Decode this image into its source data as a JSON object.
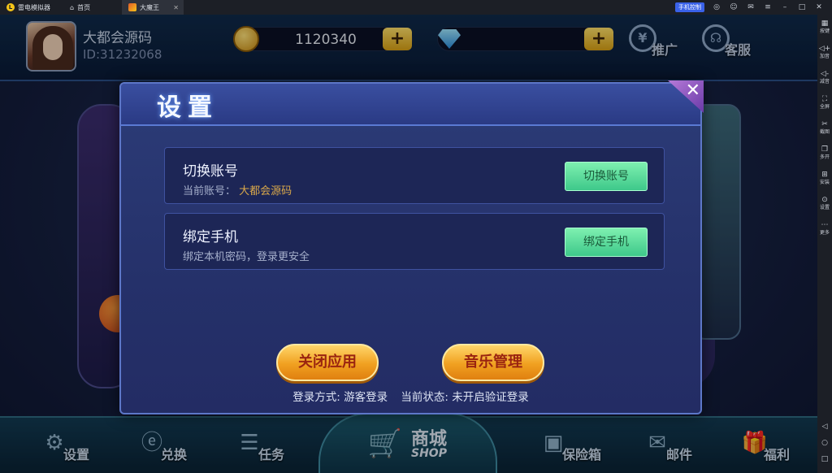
{
  "titlebar": {
    "app_name": "雷电模拟器",
    "tabs": [
      {
        "label": "首页",
        "icon": "home-icon"
      },
      {
        "label": "大魔王",
        "icon": "game-icon"
      }
    ],
    "phone_control": "手机控制"
  },
  "sidebar": {
    "items": [
      {
        "label": "按键",
        "icon": "keymap-icon"
      },
      {
        "label": "加音",
        "icon": "volume-up-icon"
      },
      {
        "label": "减音",
        "icon": "volume-down-icon"
      },
      {
        "label": "全屏",
        "icon": "fullscreen-icon"
      },
      {
        "label": "截图",
        "icon": "scissors-icon"
      },
      {
        "label": "多开",
        "icon": "multi-instance-icon"
      },
      {
        "label": "安装",
        "icon": "install-icon"
      },
      {
        "label": "设置",
        "icon": "settings-icon"
      },
      {
        "label": "更多",
        "icon": "more-icon"
      }
    ]
  },
  "user": {
    "name": "大都会源码",
    "id": "ID:31232068"
  },
  "currency": {
    "coins": "1120340",
    "gems": ""
  },
  "top_buttons": {
    "promote": "推广",
    "service": "客服"
  },
  "bottom_nav": {
    "settings": "设置",
    "exchange": "兑换",
    "tasks": "任务",
    "shop_cn": "商城",
    "shop_en": "SHOP",
    "safe": "保险箱",
    "mail": "邮件",
    "welfare": "福利"
  },
  "modal": {
    "title": "设置",
    "switch_account": {
      "title": "切换账号",
      "subtitle_prefix": "当前账号：",
      "subtitle_value": "大都会源码",
      "button": "切换账号"
    },
    "bind_phone": {
      "title": "绑定手机",
      "subtitle": "绑定本机密码，登录更安全",
      "button": "绑定手机"
    },
    "close_app_button": "关闭应用",
    "music_button": "音乐管理",
    "login_method": "登录方式:  游客登录",
    "login_status": "当前状态:  未开启验证登录"
  }
}
